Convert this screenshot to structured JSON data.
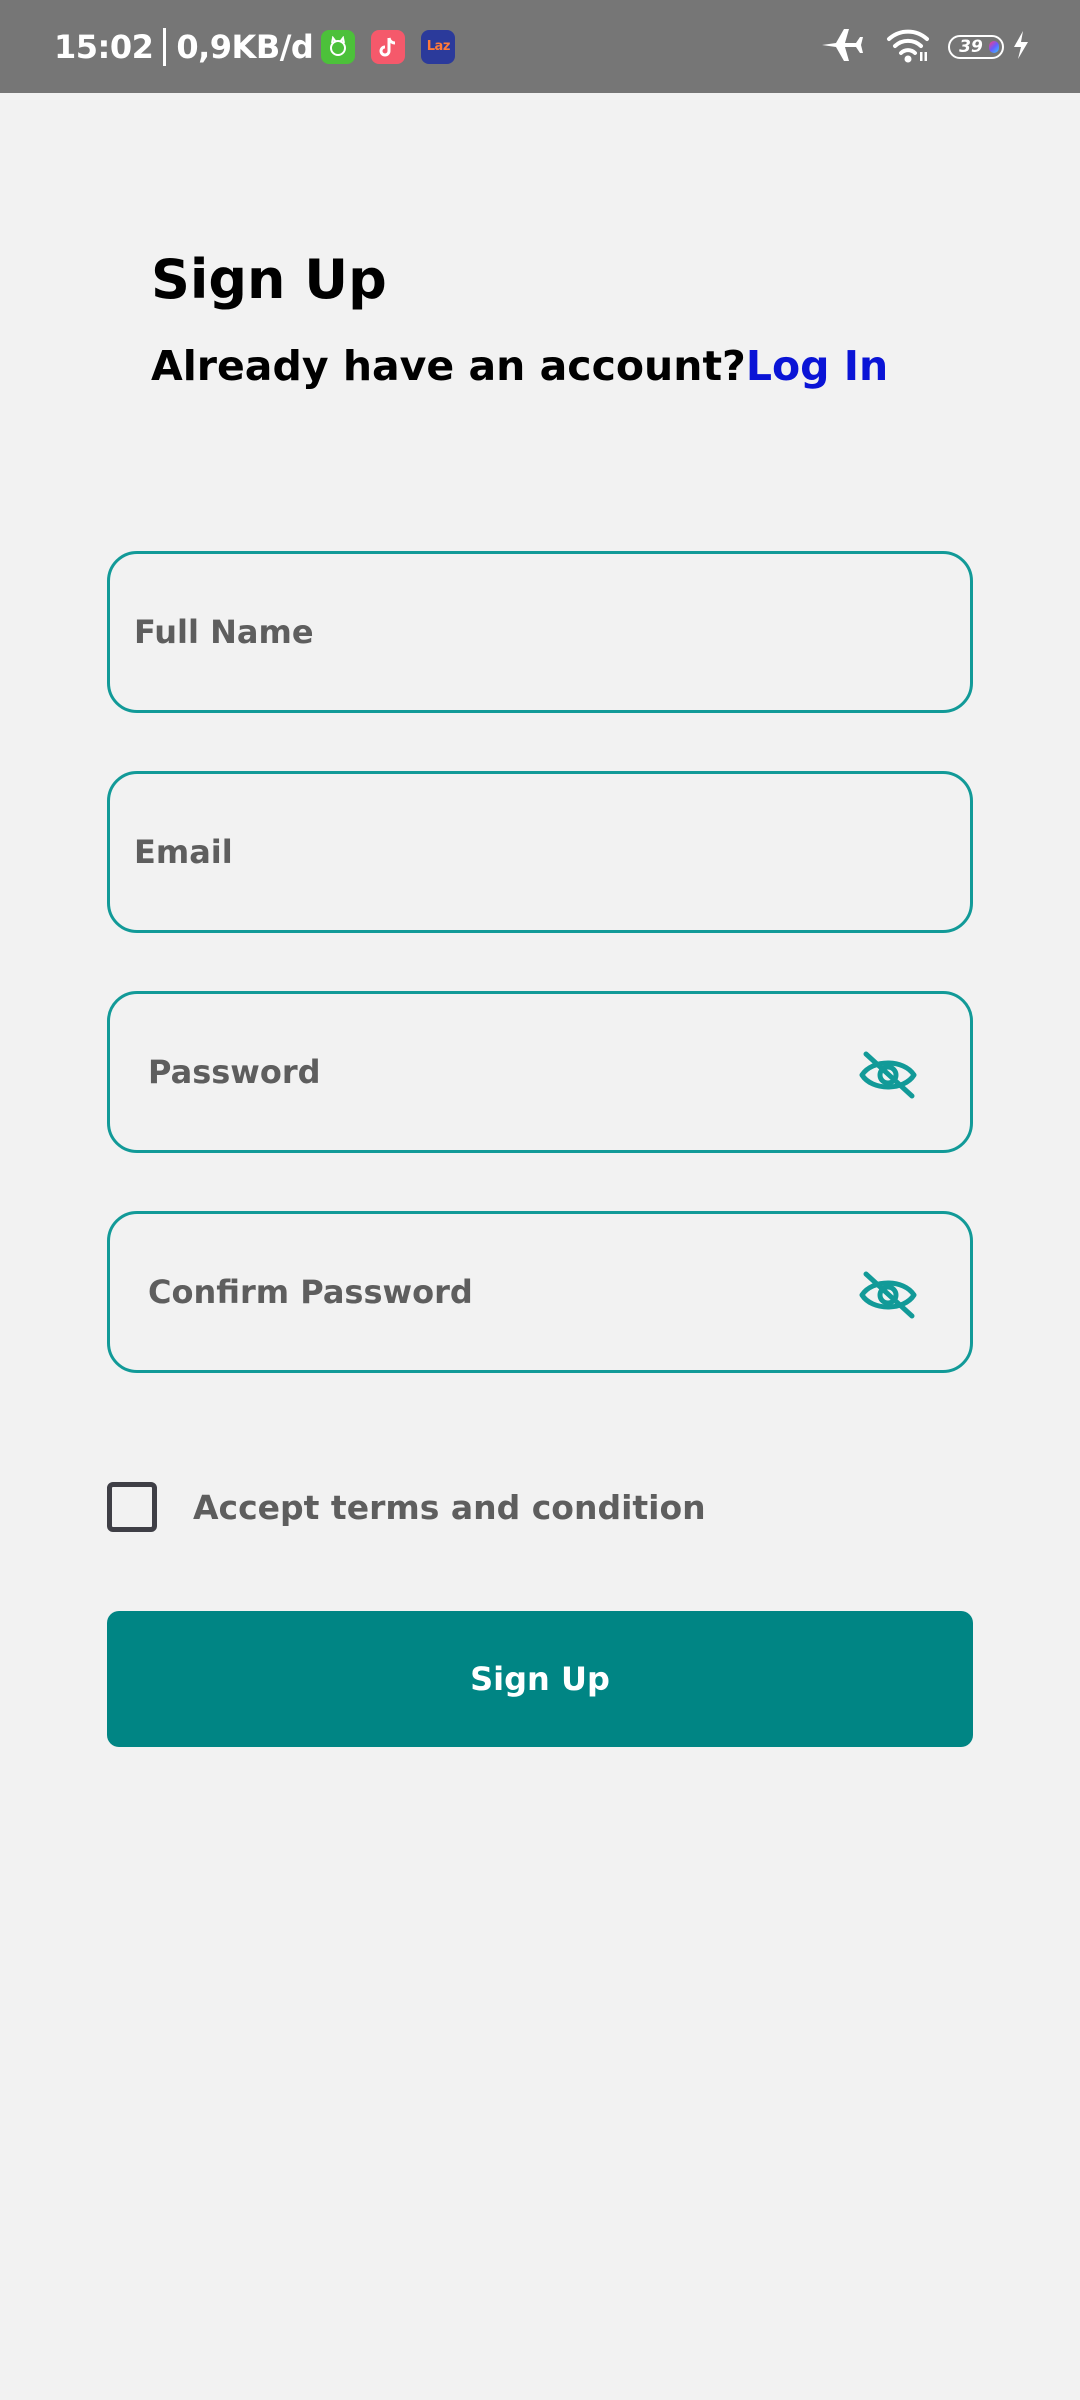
{
  "status_bar": {
    "time": "15:02",
    "network_speed": "0,9KB/d",
    "app_icons": [
      "green-cat-app-icon",
      "music-app-icon",
      "laz-app-icon"
    ],
    "laz_label": "Laz",
    "battery_level": "39",
    "airplane_mode": true,
    "charging": true
  },
  "header": {
    "title": "Sign Up",
    "subtitle_prefix": "Already have an account?",
    "login_link": "Log In"
  },
  "form": {
    "full_name": {
      "placeholder": "Full Name",
      "value": ""
    },
    "email": {
      "placeholder": "Email",
      "value": ""
    },
    "password": {
      "placeholder": "Password",
      "value": "",
      "icon": "eye-off-icon"
    },
    "confirm_password": {
      "placeholder": "Confirm Password",
      "value": "",
      "icon": "eye-off-icon"
    },
    "terms": {
      "label": "Accept terms and condition",
      "checked": false
    },
    "submit_label": "Sign Up"
  },
  "colors": {
    "accent": "#008584",
    "field_border": "#129a98",
    "link": "#0a14d6",
    "background": "#f2f2f2",
    "status_bar": "#767676"
  }
}
